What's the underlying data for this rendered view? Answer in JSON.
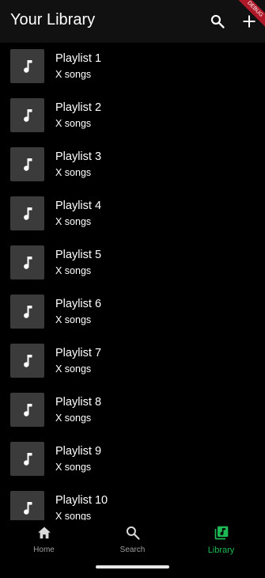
{
  "header": {
    "title": "Your Library",
    "search_icon": "search-icon",
    "add_icon": "add-icon",
    "debug_banner": "DEBUG"
  },
  "playlists": [
    {
      "title": "Playlist 1",
      "subtitle": "X songs"
    },
    {
      "title": "Playlist 2",
      "subtitle": "X songs"
    },
    {
      "title": "Playlist 3",
      "subtitle": "X songs"
    },
    {
      "title": "Playlist 4",
      "subtitle": "X songs"
    },
    {
      "title": "Playlist 5",
      "subtitle": "X songs"
    },
    {
      "title": "Playlist 6",
      "subtitle": "X songs"
    },
    {
      "title": "Playlist 7",
      "subtitle": "X songs"
    },
    {
      "title": "Playlist 8",
      "subtitle": "X songs"
    },
    {
      "title": "Playlist 9",
      "subtitle": "X songs"
    },
    {
      "title": "Playlist 10",
      "subtitle": "X songs"
    }
  ],
  "bottom_nav": {
    "items": [
      {
        "label": "Home",
        "icon": "home-icon",
        "active": false
      },
      {
        "label": "Search",
        "icon": "search-icon",
        "active": false
      },
      {
        "label": "Library",
        "icon": "library-music-icon",
        "active": true
      }
    ]
  },
  "colors": {
    "accent": "#1db954",
    "background": "#000000",
    "app_bar": "#111111",
    "thumbnail": "#3b3b3b",
    "inactive_nav": "#9e9e9e"
  }
}
